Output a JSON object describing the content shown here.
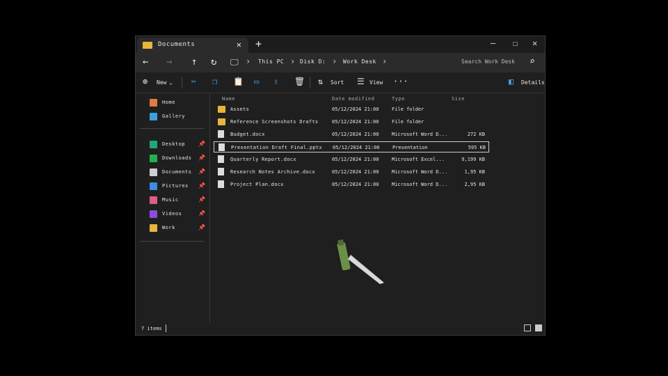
{
  "tab": {
    "title": "Documents",
    "close": "✕",
    "new": "+"
  },
  "window_controls": {
    "minimize": "—",
    "maximize": "☐",
    "close": "✕"
  },
  "address": {
    "back": "←",
    "forward": "→",
    "up": "↑",
    "refresh": "↻",
    "crumbs": [
      "This PC",
      "Disk D:",
      "Work Desk"
    ],
    "search_placeholder": "Search Work Desk"
  },
  "toolbar": {
    "new_label": "New",
    "sort_label": "Sort",
    "view_label": "View",
    "more": "···",
    "details_label": "Details"
  },
  "sidebar": {
    "top": [
      {
        "label": "Home",
        "color": "#e07c3c"
      },
      {
        "label": "Gallery",
        "color": "#3ca0e0"
      }
    ],
    "pinned": [
      {
        "label": "Desktop",
        "color": "#1fa67a"
      },
      {
        "label": "Downloads",
        "color": "#22b14c"
      },
      {
        "label": "Documents",
        "color": "#cfcfcf"
      },
      {
        "label": "Pictures",
        "color": "#3c8ce0"
      },
      {
        "label": "Music",
        "color": "#e05c8c"
      },
      {
        "label": "Videos",
        "color": "#8c4ce0"
      },
      {
        "label": "Work",
        "color": "#e8b43c"
      }
    ]
  },
  "columns": {
    "name": "Name",
    "date": "Date modified",
    "type": "Type",
    "size": "Size"
  },
  "files": [
    {
      "name": "Assets",
      "date": "05/12/2024 21:00",
      "type": "File folder",
      "size": "",
      "kind": "folder"
    },
    {
      "name": "Reference Screenshots Drafts",
      "date": "05/12/2024 21:00",
      "type": "File folder",
      "size": "",
      "kind": "folder"
    },
    {
      "name": "Budget.docx",
      "date": "05/12/2024 21:00",
      "type": "Microsoft Word D...",
      "size": "272 KB",
      "kind": "file"
    },
    {
      "name": "Presentation Draft Final.pptx",
      "date": "05/12/2024 21:00",
      "type": "Presentation",
      "size": "595 KB",
      "kind": "file",
      "selected": true
    },
    {
      "name": "Quarterly Report.docx",
      "date": "05/12/2024 21:00",
      "type": "Microsoft Excel...",
      "size": "9,199 KB",
      "kind": "file"
    },
    {
      "name": "Research Notes Archive.docx",
      "date": "05/12/2024 21:00",
      "type": "Microsoft Word D...",
      "size": "1,95 KB",
      "kind": "file"
    },
    {
      "name": "Project Plan.docx",
      "date": "05/12/2024 21:00",
      "type": "Microsoft Word D...",
      "size": "2,95 KB",
      "kind": "file"
    }
  ],
  "status": {
    "items": "7 items"
  }
}
